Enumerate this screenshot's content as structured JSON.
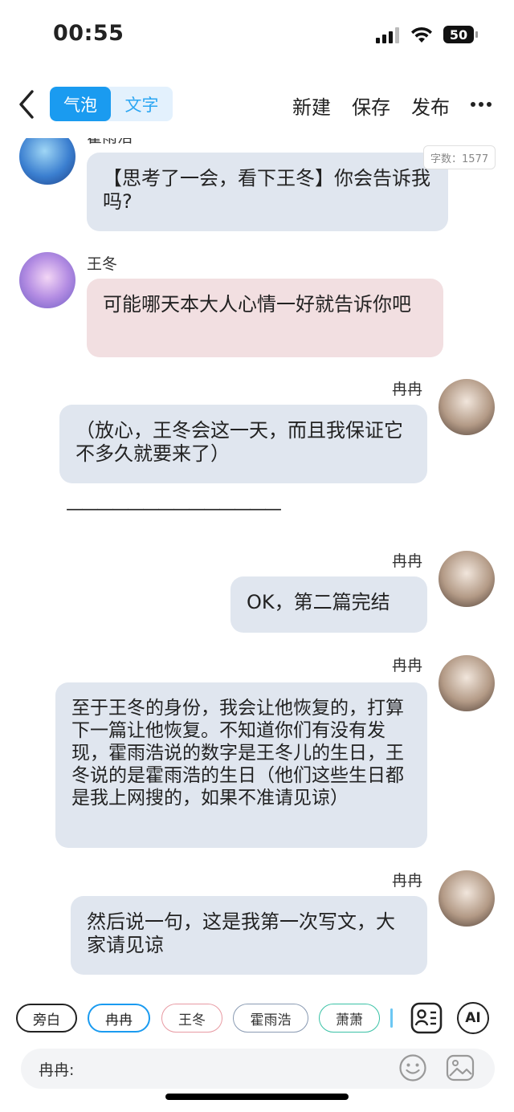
{
  "status_bar": {
    "time": "00:55",
    "battery": "50"
  },
  "nav": {
    "seg_bubble": "气泡",
    "seg_text": "文字",
    "new": "新建",
    "save": "保存",
    "publish": "发布"
  },
  "word_count": "字数：1577",
  "messages": [
    {
      "speaker": "霍雨浩",
      "text": "【思考了一会，看下王冬】你会告诉我吗?"
    },
    {
      "speaker": "王冬",
      "text": "可能哪天本大人心情一好就告诉你吧"
    },
    {
      "speaker": "冉冉",
      "text": "（放心，王冬会这一天，而且我保证它不多久就要来了）"
    },
    {
      "divider": "——————————————"
    },
    {
      "speaker": "冉冉",
      "text": "OK，第二篇完结"
    },
    {
      "speaker": "冉冉",
      "text": "至于王冬的身份，我会让他恢复的，打算下一篇让他恢复。不知道你们有没有发现，霍雨浩说的数字是王冬儿的生日，王冬说的是霍雨浩的生日（他们这些生日都是我上网搜的，如果不准请见谅）"
    },
    {
      "speaker": "冉冉",
      "text": "然后说一句，这是我第一次写文，大家请见谅"
    }
  ],
  "bottom": {
    "chips": [
      "旁白",
      "冉冉",
      "王冬",
      "霍雨浩",
      "萧萧"
    ],
    "ai_label": "AI",
    "input_label": "冉冉:"
  },
  "colors": {
    "accent": "#1a9bf0",
    "bubble_gray": "#e0e6ef",
    "bubble_pink": "#f2dfe1"
  }
}
